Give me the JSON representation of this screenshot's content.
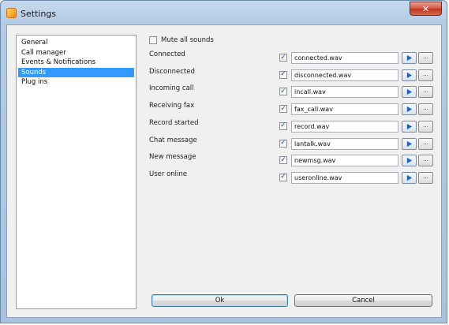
{
  "window": {
    "title": "Settings",
    "close_glyph": "✕"
  },
  "icons": {
    "app": "app-icon",
    "close": "close-icon",
    "play": "play-icon",
    "check": "check-icon"
  },
  "colors": {
    "selection": "#3399ff",
    "play_arrow": "#2266bb",
    "titlebar": "#b5cbe4"
  },
  "nav": {
    "items": [
      {
        "label": "General"
      },
      {
        "label": "Call manager"
      },
      {
        "label": "Events & Notifications"
      },
      {
        "label": "Sounds",
        "selected": true
      },
      {
        "label": "Plug ins"
      }
    ]
  },
  "sounds": {
    "mute_label": "Mute all sounds",
    "mute_checked": false,
    "browse_label": "...",
    "rows": [
      {
        "event": "Connected",
        "checked": true,
        "file": "connected.wav"
      },
      {
        "event": "Disconnected",
        "checked": true,
        "file": "disconnected.wav"
      },
      {
        "event": "Incoming call",
        "checked": true,
        "file": "incall.wav"
      },
      {
        "event": "Receiving fax",
        "checked": true,
        "file": "fax_call.wav"
      },
      {
        "event": "Record started",
        "checked": true,
        "file": "record.wav"
      },
      {
        "event": "Chat message",
        "checked": true,
        "file": "lantalk.wav"
      },
      {
        "event": "New message",
        "checked": true,
        "file": "newmsg.wav"
      },
      {
        "event": "User online",
        "checked": true,
        "file": "useronline.wav"
      }
    ]
  },
  "buttons": {
    "ok": "Ok",
    "cancel": "Cancel"
  }
}
